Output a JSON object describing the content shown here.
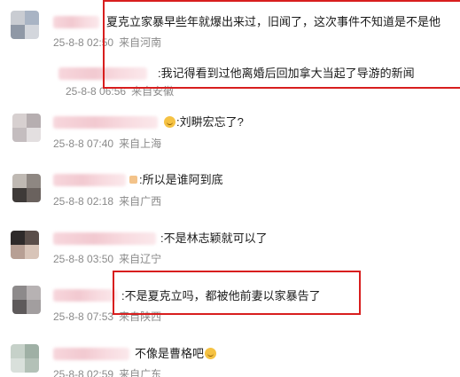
{
  "colors": {
    "highlight": "#d81e1e",
    "meta_text": "#8a8a8a",
    "body_text": "#1a1a1a",
    "name_blur": "#f2c9d0"
  },
  "comments": [
    {
      "text": "夏克立家暴早些年就爆出来过，旧闻了，这次事件不知道是不是他",
      "date": "25-8-8 02:50",
      "location": "来自河南"
    },
    {
      "text": ":我记得看到过他离婚后回加拿大当起了导游的新闻",
      "date": "25-8-8 06:56",
      "location": "来自安徽"
    },
    {
      "text": ":刘畊宏忘了?",
      "date": "25-8-8 07:40",
      "location": "来自上海"
    },
    {
      "text": ":所以是谁阿到底",
      "date": "25-8-8 02:18",
      "location": "来自广西"
    },
    {
      "text": ":不是林志颖就可以了",
      "date": "25-8-8 03:50",
      "location": "来自辽宁"
    },
    {
      "text": ":不是夏克立吗，都被他前妻以家暴告了",
      "date": "25-8-8 07:53",
      "location": "来自陕西"
    },
    {
      "text": "不像是曹格吧",
      "date": "25-8-8 02:59",
      "location": "来自广东"
    }
  ]
}
